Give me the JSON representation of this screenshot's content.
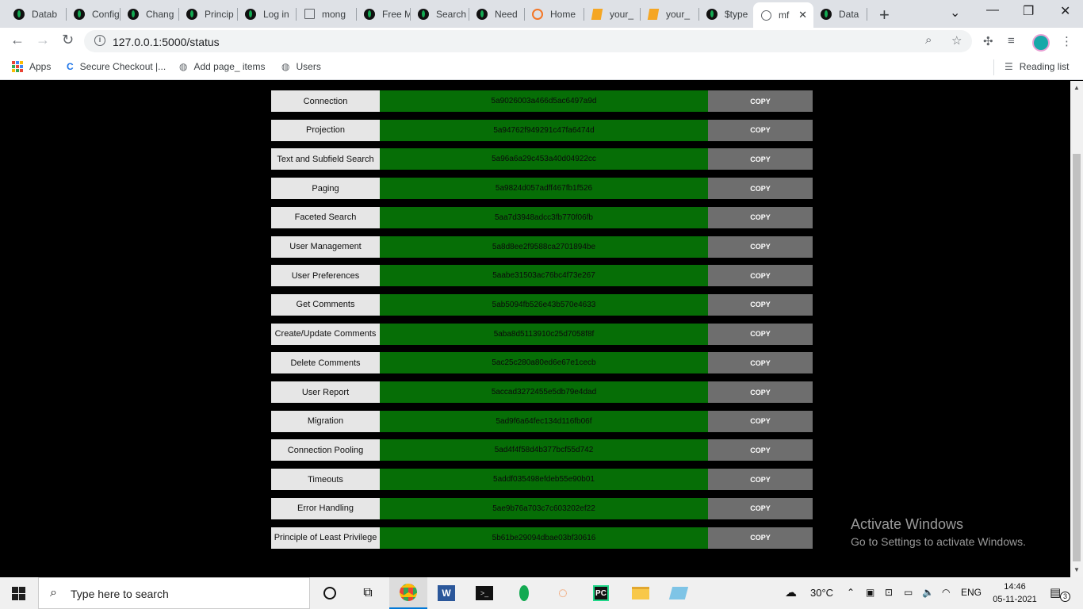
{
  "browser": {
    "tabs": [
      {
        "title": "Datab",
        "favicon": "mongodb-leaf-icon"
      },
      {
        "title": "Config",
        "favicon": "mongodb-leaf-icon"
      },
      {
        "title": "Chang",
        "favicon": "mongodb-leaf-icon"
      },
      {
        "title": "Princip",
        "favicon": "mongodb-leaf-icon"
      },
      {
        "title": "Log in",
        "favicon": "mongodb-leaf-icon"
      },
      {
        "title": "mong",
        "favicon": "document-icon"
      },
      {
        "title": "Free M",
        "favicon": "mongodb-leaf-icon"
      },
      {
        "title": "Search",
        "favicon": "mongodb-leaf-icon"
      },
      {
        "title": "Need",
        "favicon": "mongodb-leaf-icon"
      },
      {
        "title": "Home",
        "favicon": "jupyter-icon"
      },
      {
        "title": "your_",
        "favicon": "notebook-icon"
      },
      {
        "title": "your_",
        "favicon": "notebook-icon"
      },
      {
        "title": "$type",
        "favicon": "mongodb-leaf-icon"
      },
      {
        "title": "mf",
        "favicon": "globe-icon"
      },
      {
        "title": "Data",
        "favicon": "mongodb-leaf-icon"
      }
    ],
    "active_tab_close": "✕",
    "url": "127.0.0.1:5000/status",
    "bookmarks": [
      {
        "label": "Apps"
      },
      {
        "label": "Secure Checkout |..."
      },
      {
        "label": "Add page_ items"
      },
      {
        "label": "Users"
      }
    ],
    "reading_list": "Reading list"
  },
  "status_rows": [
    {
      "label": "Connection",
      "code": "5a9026003a466d5ac6497a9d",
      "button": "COPY"
    },
    {
      "label": "Projection",
      "code": "5a94762f949291c47fa6474d",
      "button": "COPY"
    },
    {
      "label": "Text and Subfield Search",
      "code": "5a96a6a29c453a40d04922cc",
      "button": "COPY"
    },
    {
      "label": "Paging",
      "code": "5a9824d057adff467fb1f526",
      "button": "COPY"
    },
    {
      "label": "Faceted Search",
      "code": "5aa7d3948adcc3fb770f06fb",
      "button": "COPY"
    },
    {
      "label": "User Management",
      "code": "5a8d8ee2f9588ca2701894be",
      "button": "COPY"
    },
    {
      "label": "User Preferences",
      "code": "5aabe31503ac76bc4f73e267",
      "button": "COPY"
    },
    {
      "label": "Get Comments",
      "code": "5ab5094fb526e43b570e4633",
      "button": "COPY"
    },
    {
      "label": "Create/Update Comments",
      "code": "5aba8d5113910c25d7058f8f",
      "button": "COPY"
    },
    {
      "label": "Delete Comments",
      "code": "5ac25c280a80ed6e67e1cecb",
      "button": "COPY"
    },
    {
      "label": "User Report",
      "code": "5accad3272455e5db79e4dad",
      "button": "COPY"
    },
    {
      "label": "Migration",
      "code": "5ad9f6a64fec134d116fb06f",
      "button": "COPY"
    },
    {
      "label": "Connection Pooling",
      "code": "5ad4f4f58d4b377bcf55d742",
      "button": "COPY"
    },
    {
      "label": "Timeouts",
      "code": "5addf035498efdeb55e90b01",
      "button": "COPY"
    },
    {
      "label": "Error Handling",
      "code": "5ae9b76a703c7c603202ef22",
      "button": "COPY"
    },
    {
      "label": "Principle of Least Privilege",
      "code": "5b61be29094dbae03bf30616",
      "button": "COPY"
    }
  ],
  "watermark": {
    "title": "Activate Windows",
    "subtitle": "Go to Settings to activate Windows."
  },
  "taskbar": {
    "search_placeholder": "Type here to search",
    "temperature": "30°C",
    "language": "ENG",
    "time": "14:46",
    "date": "05-11-2021",
    "notifications": "3"
  },
  "colors": {
    "code_bg": "#066e06",
    "label_bg": "#e6e6e6",
    "button_bg": "#6e6e6e",
    "page_bg": "#000000"
  }
}
